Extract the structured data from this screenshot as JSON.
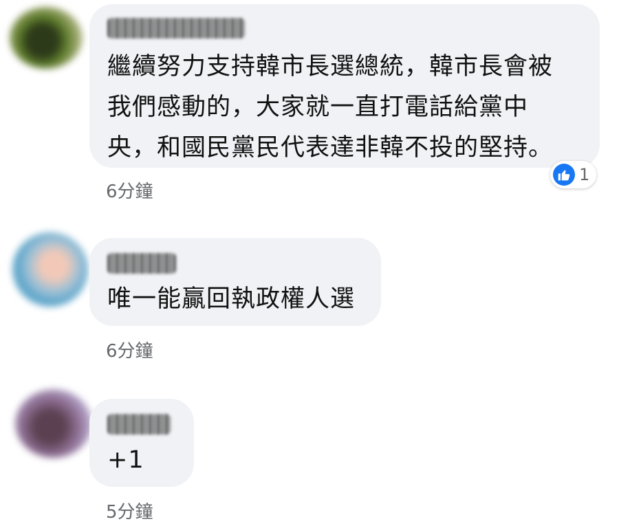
{
  "comments": [
    {
      "text": "繼續努力支持韓市長選總統，韓市長會被\n我們感動的，大家就一直打電話給黨中\n央，和國民黨民代表達非韓不投的堅持。",
      "time": "6分鐘",
      "reaction_count": "1",
      "reaction_icon": "thumbs-up-icon",
      "avatar_color": "#4e5a2c"
    },
    {
      "text": "唯一能贏回執政權人選",
      "time": "6分鐘",
      "avatar_color": "#7aa7c2"
    },
    {
      "text": "+1",
      "time": "5分鐘",
      "avatar_color": "#6b5a7a"
    }
  ],
  "colors": {
    "bubble_bg": "#f0f2f5",
    "like_blue": "#1877f2",
    "timestamp": "#65676b"
  }
}
